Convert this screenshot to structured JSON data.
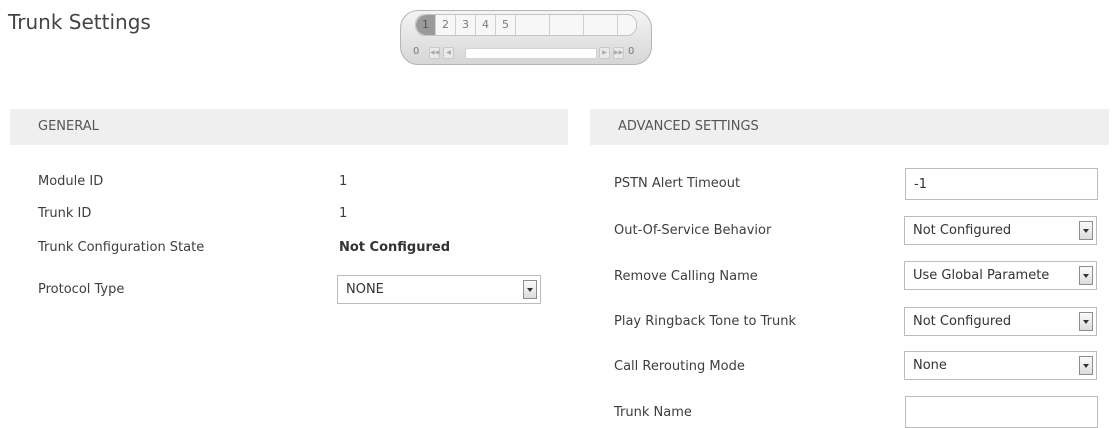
{
  "page": {
    "title": "Trunk Settings"
  },
  "trunk_nav": {
    "tabs": [
      "1",
      "2",
      "3",
      "4",
      "5"
    ],
    "active_tab": "1",
    "left_count": "0",
    "right_count": "0",
    "first_icon": "first-page-icon",
    "prev_icon": "prev-page-icon",
    "next_icon": "next-page-icon",
    "last_icon": "last-page-icon"
  },
  "general": {
    "header": "GENERAL",
    "module_id": {
      "label": "Module ID",
      "value": "1"
    },
    "trunk_id": {
      "label": "Trunk ID",
      "value": "1"
    },
    "config_state": {
      "label": "Trunk Configuration State",
      "value": "Not Configured"
    },
    "protocol_type": {
      "label": "Protocol Type",
      "value": "NONE"
    }
  },
  "advanced": {
    "header": "ADVANCED SETTINGS",
    "pstn_alert_timeout": {
      "label": "PSTN Alert Timeout",
      "value": "-1"
    },
    "out_of_service_behavior": {
      "label": "Out-Of-Service Behavior",
      "value": "Not Configured"
    },
    "remove_calling_name": {
      "label": "Remove Calling Name",
      "value": "Use Global Paramete"
    },
    "play_ringback_tone": {
      "label": "Play Ringback Tone to Trunk",
      "value": "Not Configured"
    },
    "call_rerouting_mode": {
      "label": "Call Rerouting Mode",
      "value": "None"
    },
    "trunk_name": {
      "label": "Trunk Name",
      "value": ""
    }
  }
}
